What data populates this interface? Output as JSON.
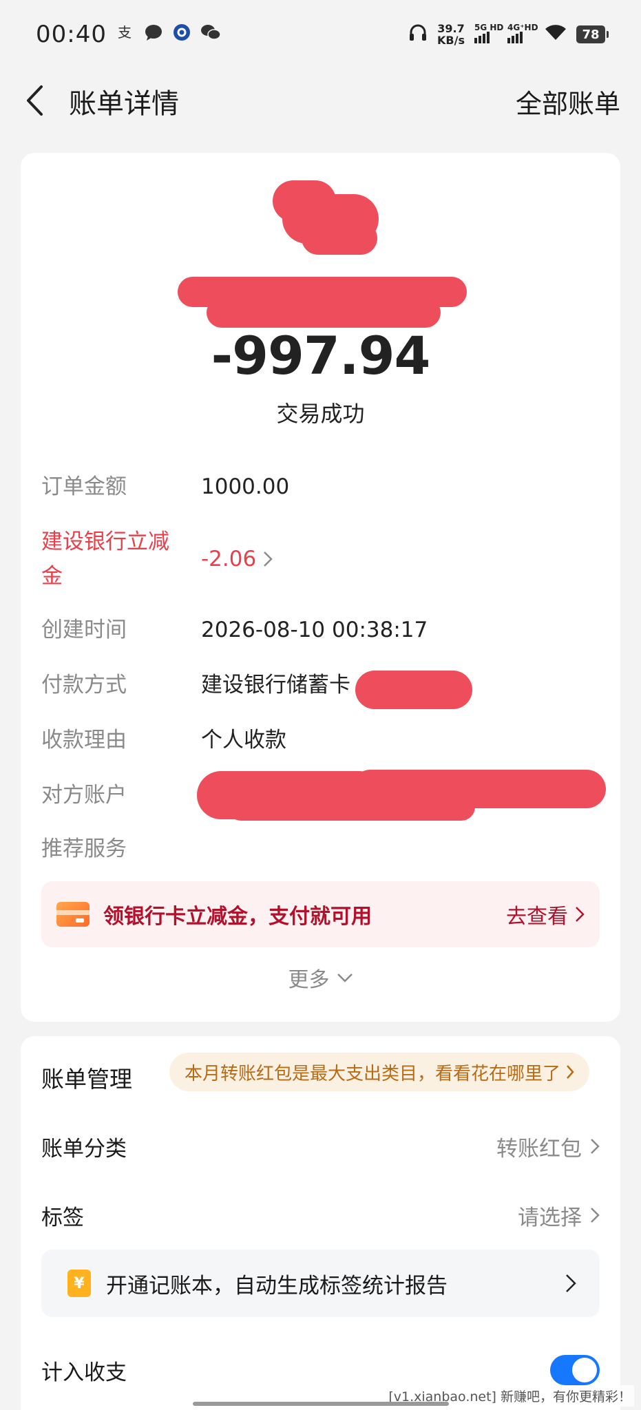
{
  "status_bar": {
    "time": "00:40",
    "net_speed_value": "39.7",
    "net_speed_unit": "KB/s",
    "signal1_label": "5G HD",
    "signal2_label": "4G⁺HD",
    "battery": "78",
    "icons": [
      "alipay-icon",
      "message-icon",
      "app-icon",
      "wechat-icon",
      "headphone-icon",
      "wifi-icon"
    ]
  },
  "header": {
    "title": "账单详情",
    "right_link": "全部账单"
  },
  "summary": {
    "amount": "-997.94",
    "status": "交易成功"
  },
  "details": [
    {
      "key": "订单金额",
      "value": "1000.00"
    },
    {
      "key": "建设银行立减金",
      "value": "-2.06"
    },
    {
      "key": "创建时间",
      "value": "2026-08-10 00:38:17"
    },
    {
      "key": "付款方式",
      "value": "建设银行储蓄卡"
    },
    {
      "key": "收款理由",
      "value": "个人收款"
    },
    {
      "key": "对方账户",
      "value": ""
    },
    {
      "key": "推荐服务",
      "value": ""
    }
  ],
  "promo": {
    "text": "领银行卡立减金，支付就可用",
    "link": "去查看"
  },
  "more_label": "更多",
  "management": {
    "title": "账单管理",
    "tip": "本月转账红包是最大支出类目，看看花在哪里了",
    "category_label": "账单分类",
    "category_value": "转账红包",
    "tag_label": "标签",
    "tag_value": "请选择",
    "book_text": "开通记账本，自动生成标签统计报告",
    "book_icon": "¥",
    "income_label": "计入收支"
  },
  "watermark": "[v1.xianbao.net] 新赚吧，有你更精彩！",
  "colors": {
    "accent_red": "#e8404b",
    "promo_text": "#b3112b",
    "tip_text": "#b86b15",
    "toggle": "#1677ff"
  }
}
